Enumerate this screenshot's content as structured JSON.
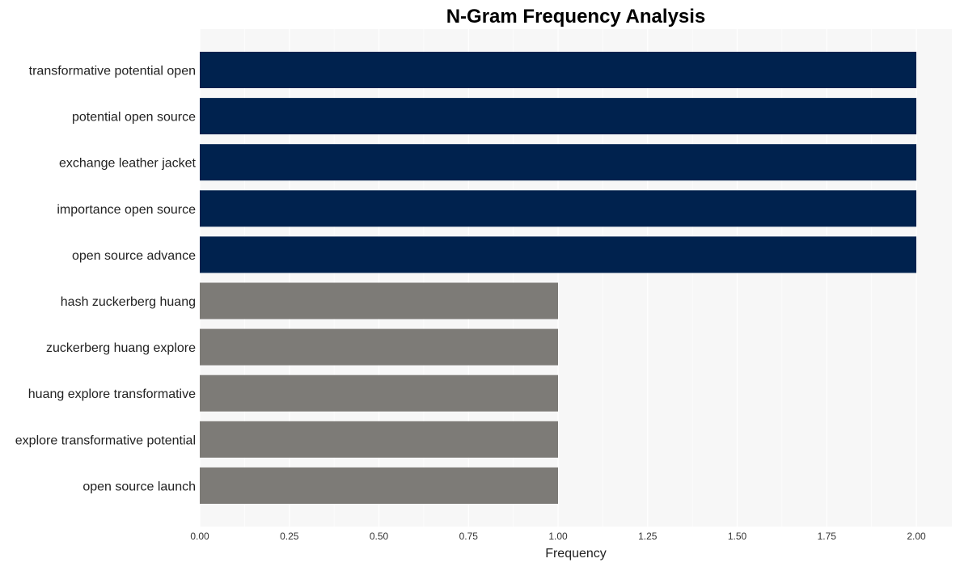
{
  "chart_data": {
    "type": "bar",
    "orientation": "horizontal",
    "title": "N-Gram Frequency Analysis",
    "xlabel": "Frequency",
    "ylabel": "",
    "xlim": [
      0,
      2.1
    ],
    "x_ticks": [
      "0.00",
      "0.25",
      "0.50",
      "0.75",
      "1.00",
      "1.25",
      "1.50",
      "1.75",
      "2.00"
    ],
    "grid": true,
    "categories": [
      "transformative potential open",
      "potential open source",
      "exchange leather jacket",
      "importance open source",
      "open source advance",
      "hash zuckerberg huang",
      "zuckerberg huang explore",
      "huang explore transformative",
      "explore transformative potential",
      "open source launch"
    ],
    "values": [
      2,
      2,
      2,
      2,
      2,
      1,
      1,
      1,
      1,
      1
    ],
    "colors": {
      "high": "#00224e",
      "low": "#7d7b77",
      "panel": "#f7f7f7",
      "grid": "#ffffff"
    }
  }
}
